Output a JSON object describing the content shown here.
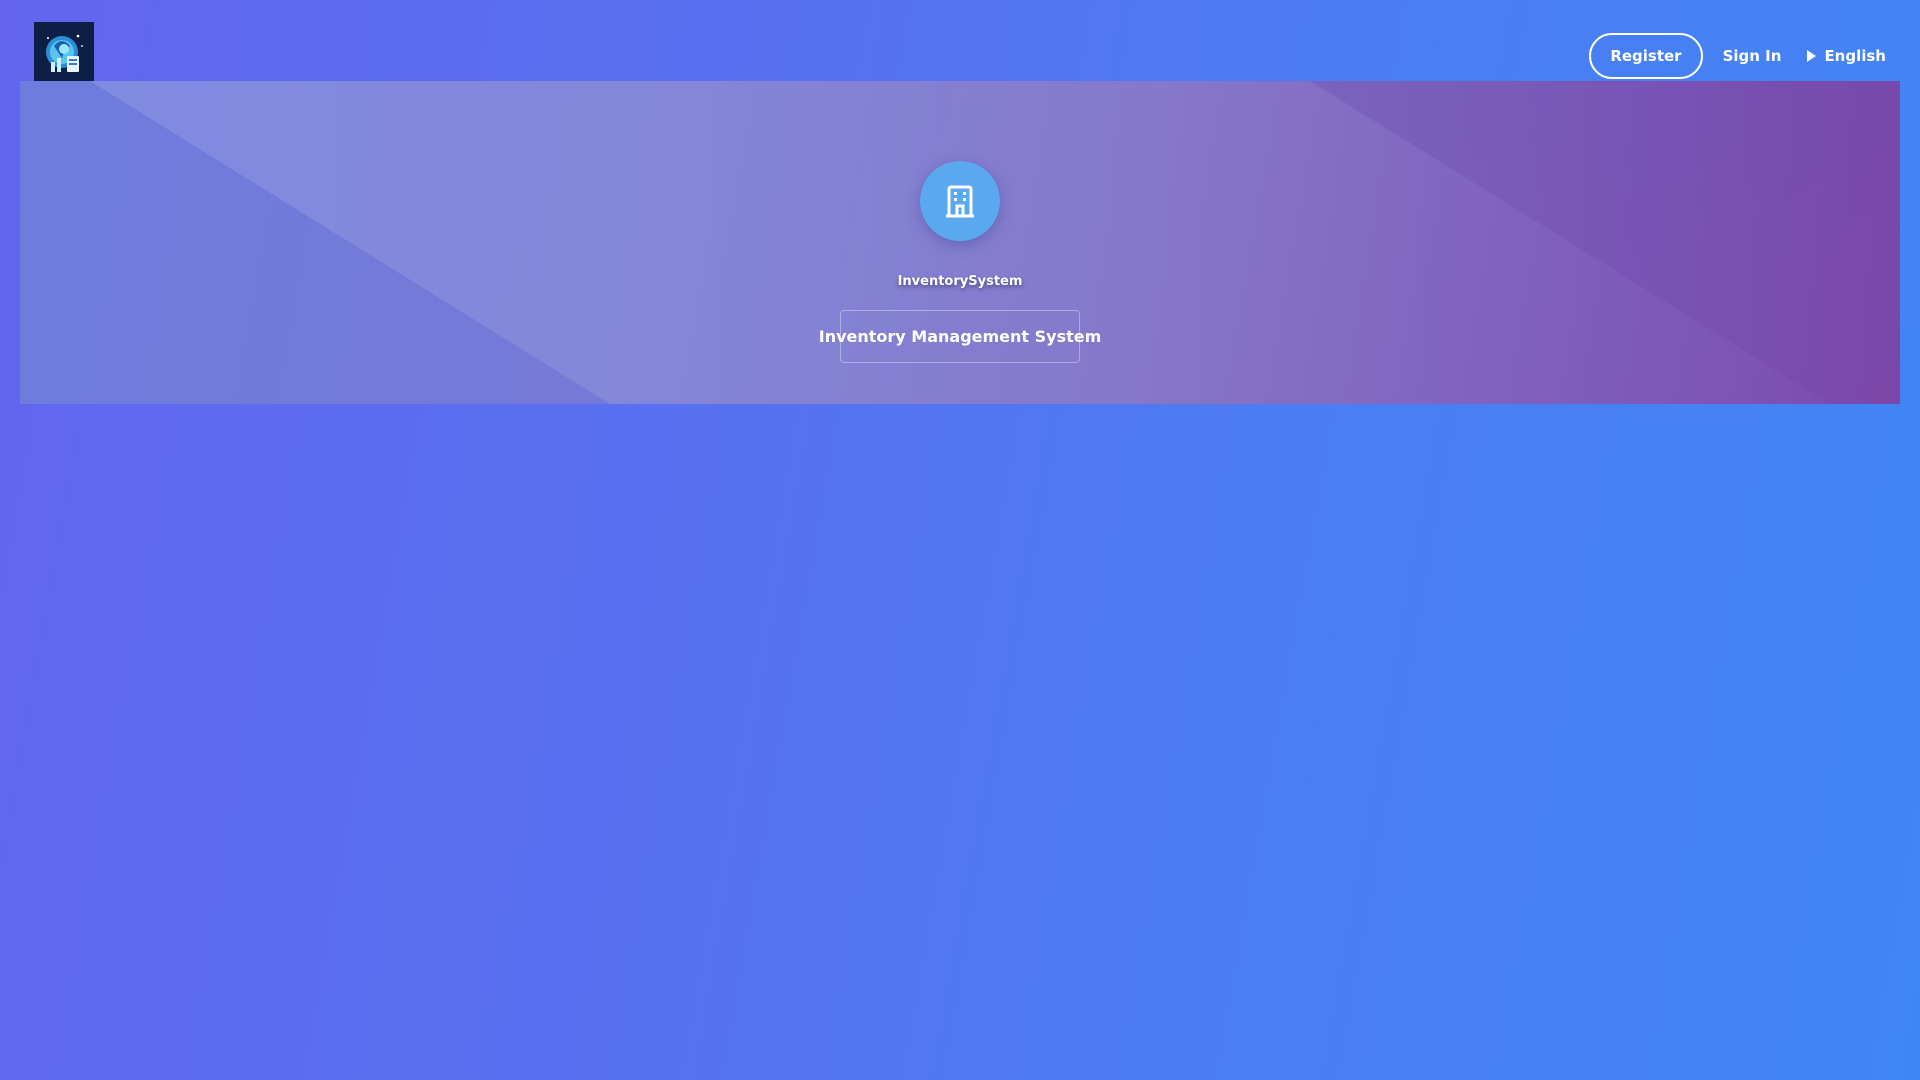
{
  "header": {
    "logo_icon": "app-logo-icon",
    "register_label": "Register",
    "signin_label": "Sign In",
    "language_label": "English"
  },
  "hero": {
    "icon": "building-icon",
    "app_name": "InventorySystem",
    "subtitle": "Inventory Management System"
  },
  "colors": {
    "page_gradient_start": "#6365ef",
    "page_gradient_end": "#3f86f5",
    "hero_icon_bg": "#5aa9ef",
    "hero_gradient_start": "#707fdf",
    "hero_gradient_end": "#7a46a9"
  }
}
